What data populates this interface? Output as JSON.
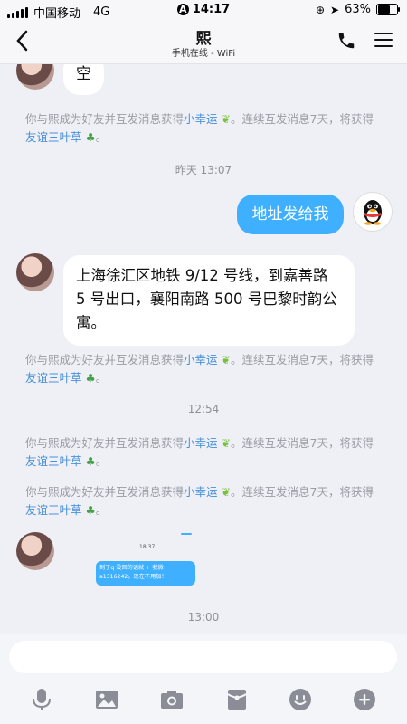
{
  "status_bar": {
    "carrier": "中国移动",
    "network": "4G",
    "time": "14:17",
    "battery": "63%",
    "battery_level": 0.63
  },
  "header": {
    "title": "熙",
    "subtitle": "手机在线 - WiFi"
  },
  "messages": {
    "top_bubble": "空",
    "system_1": {
      "prefix": "你与熙成为好友并互发消息获得",
      "link1": "小幸运",
      "mid": "。连续互发消息7天，将获得",
      "link2": "友谊三叶草",
      "suffix": "。"
    },
    "ts_1": "昨天 13:07",
    "out_msg": "地址发给我",
    "in_msg": "上海徐汇区地铁 9/12 号线，到嘉善路 5 号出口，襄阳南路 500 号巴黎时韵公寓。",
    "system_2": {
      "prefix": "你与熙成为好友并互发消息获得",
      "link1": "小幸运",
      "mid": "。连续互发消息7天，将获得",
      "link2": "友谊三叶草",
      "suffix": "。"
    },
    "ts_2": "12:54",
    "system_3": {
      "prefix": "你与熙成为好友并互发消息获得",
      "link1": "小幸运",
      "mid": "。连续互发消息7天，将获得",
      "link2": "友谊三叶草",
      "suffix": "。"
    },
    "system_4": {
      "prefix": "你与熙成为好友并互发消息获得",
      "link1": "小幸运",
      "mid": "。连续互发消息7天，将获得",
      "link2": "友谊三叶草",
      "suffix": "。"
    },
    "img_time": "18:37",
    "img_line1": "到了q 没回的话就 + 我微",
    "img_line2": "a1316242，现在不用加！",
    "ts_3": "13:00"
  },
  "colors": {
    "accent": "#3eb0ff",
    "link": "#4a90d9",
    "system_text": "#9a9ca5"
  },
  "toolbar": {
    "icons": [
      "microphone-icon",
      "image-icon",
      "camera-icon",
      "red-packet-icon",
      "emoji-icon",
      "plus-icon"
    ]
  }
}
